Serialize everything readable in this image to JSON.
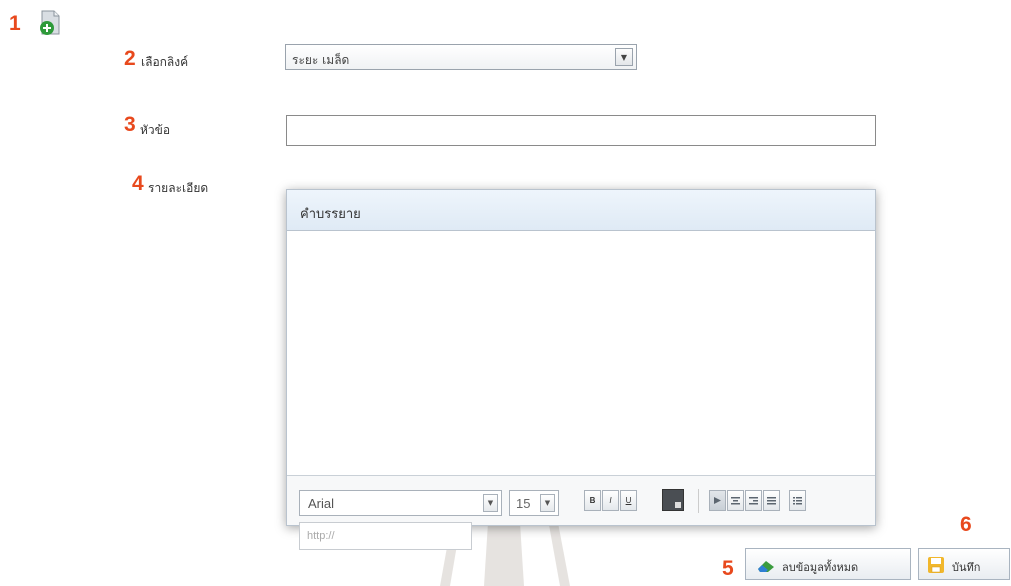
{
  "markers": {
    "m1": "1",
    "m2": "2",
    "m3": "3",
    "m4": "4",
    "m5": "5",
    "m6": "6"
  },
  "form": {
    "link_label": "เลือกลิงค์",
    "link_value": "ระยะ เมล็ด",
    "title_label": "หัวข้อ",
    "detail_label": "รายละเอียด"
  },
  "editor": {
    "header": "คำบรรยาย",
    "font": "Arial",
    "size": "15",
    "bold": "B",
    "italic": "I",
    "underline": "U",
    "url_placeholder": "http://"
  },
  "buttons": {
    "clear_label": "ลบข้อมูลทั้งหมด",
    "save_label": "บันทึก"
  },
  "colors": {
    "marker_red": "#e8491d",
    "accent_blue": "#dfeaf5"
  }
}
